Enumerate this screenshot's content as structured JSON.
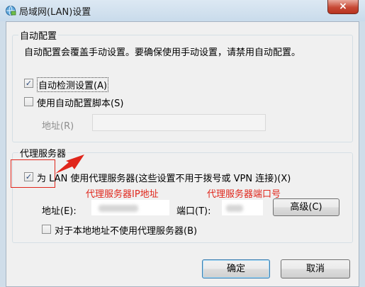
{
  "window": {
    "title": "局域网(LAN)设置",
    "close_glyph": "×",
    "icon": "network-globe-icon"
  },
  "auto_config": {
    "group_title": "自动配置",
    "description": "自动配置会覆盖手动设置。要确保使用手动设置，请禁用自动配置。",
    "detect_label": "自动检测设置(A)",
    "detect_checked": true,
    "script_label": "使用自动配置脚本(S)",
    "script_checked": false,
    "address_label": "地址(R)",
    "address_value": ""
  },
  "proxy": {
    "group_title": "代理服务器",
    "use_proxy_label": "为 LAN 使用代理服务器(这些设置不用于拨号或 VPN 连接)(X)",
    "use_proxy_checked": true,
    "address_label": "地址(E):",
    "port_label": "端口(T):",
    "advanced_label": "高级(C)",
    "bypass_local_label": "对于本地地址不使用代理服务器(B)",
    "bypass_local_checked": false
  },
  "annotations": {
    "ip_note": "代理服务器IP地址",
    "port_note": "代理服务器端口号",
    "color": "#e0261b"
  },
  "buttons": {
    "ok_label": "确定",
    "cancel_label": "取消"
  },
  "colors": {
    "close_button": "#c74a36",
    "title_bar": "#cfdde9",
    "annotation": "#e0261b"
  }
}
